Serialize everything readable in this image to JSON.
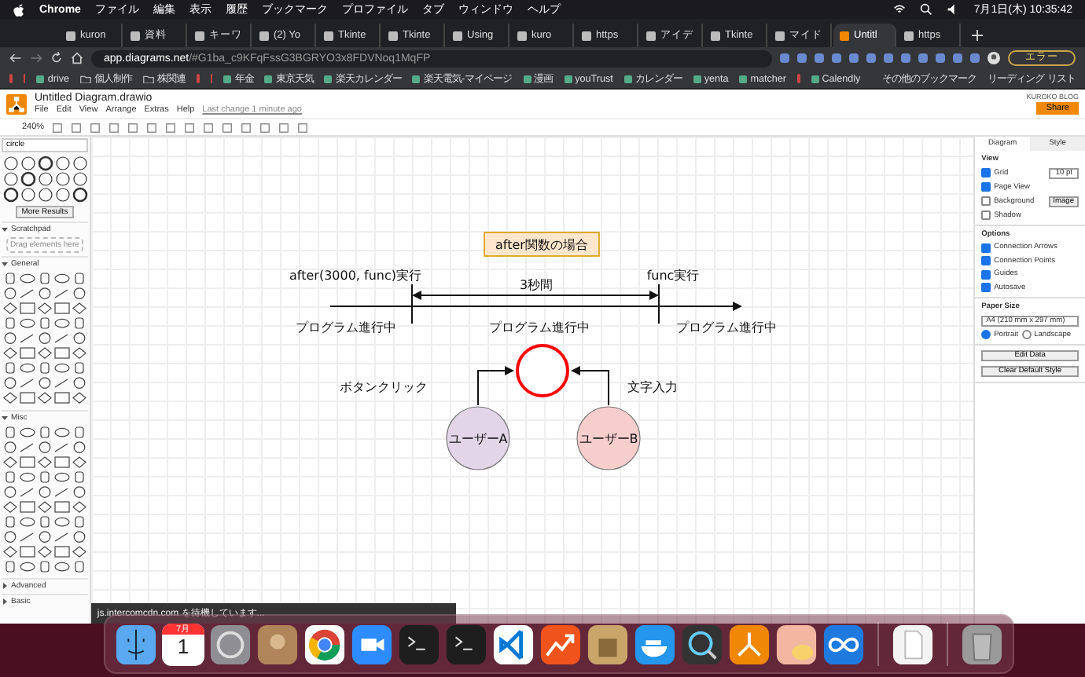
{
  "menubar": {
    "app": "Chrome",
    "items": [
      "ファイル",
      "編集",
      "表示",
      "履歴",
      "ブックマーク",
      "プロファイル",
      "タブ",
      "ウィンドウ",
      "ヘルプ"
    ],
    "clock": "7月1日(木) 10:35:42"
  },
  "browser": {
    "tabs": [
      {
        "label": "kuron",
        "selected": false
      },
      {
        "label": "資料",
        "selected": false
      },
      {
        "label": "キーワ",
        "selected": false
      },
      {
        "label": "(2) Yo",
        "selected": false
      },
      {
        "label": "Tkinte",
        "selected": false
      },
      {
        "label": "Tkinte",
        "selected": false
      },
      {
        "label": "Using",
        "selected": false
      },
      {
        "label": "kuro",
        "selected": false
      },
      {
        "label": "https",
        "selected": false
      },
      {
        "label": "アイデ",
        "selected": false
      },
      {
        "label": "Tkinte",
        "selected": false
      },
      {
        "label": "マイド",
        "selected": false
      },
      {
        "label": "Untitl",
        "selected": true
      },
      {
        "label": "https",
        "selected": false
      }
    ],
    "url_host": "app.diagrams.net",
    "url_path": "/#G1ba_c9KFqFssG3BGRYO3x8FDVNoq1MqFP",
    "error_button": "エラー",
    "bookmarks": [
      {
        "kind": "icon"
      },
      {
        "kind": "icon"
      },
      {
        "kind": "site",
        "label": "drive"
      },
      {
        "kind": "folder",
        "label": "個人制作"
      },
      {
        "kind": "folder",
        "label": "株関連"
      },
      {
        "kind": "icon"
      },
      {
        "kind": "icon"
      },
      {
        "kind": "site",
        "label": "年金"
      },
      {
        "kind": "site",
        "label": "東京天気"
      },
      {
        "kind": "site",
        "label": "楽天カレンダー"
      },
      {
        "kind": "site",
        "label": "楽天電気-マイページ"
      },
      {
        "kind": "site",
        "label": "漫画"
      },
      {
        "kind": "site",
        "label": "youTrust"
      },
      {
        "kind": "site",
        "label": "カレンダー"
      },
      {
        "kind": "site",
        "label": "yenta"
      },
      {
        "kind": "site",
        "label": "matcher"
      },
      {
        "kind": "icon"
      },
      {
        "kind": "site",
        "label": "Calendly"
      }
    ],
    "other_bookmarks": "その他のブックマーク",
    "reading_list": "リーディング リスト"
  },
  "app": {
    "title": "Untitled Diagram.drawio",
    "menu": [
      "File",
      "Edit",
      "View",
      "Arrange",
      "Extras",
      "Help"
    ],
    "last_change": "Last change 1 minute ago",
    "account": "KUROKO BLOG",
    "share": "Share",
    "zoom": "240%"
  },
  "sidebar": {
    "search": "circle",
    "more_results": "More Results",
    "sections": [
      {
        "title": "Scratchpad",
        "kind": "scratchpad",
        "expanded": true,
        "hint": "Drag elements here"
      },
      {
        "title": "General",
        "kind": "general",
        "expanded": true
      },
      {
        "title": "Misc",
        "kind": "misc",
        "expanded": true
      },
      {
        "title": "Advanced",
        "expanded": false
      },
      {
        "title": "Basic",
        "expanded": false
      }
    ]
  },
  "diagram": {
    "title": "after関数の場合",
    "start_label": "after(3000, func)実行",
    "interval": "3秒間",
    "end_label": "func実行",
    "phases": [
      "プログラム進行中",
      "プログラム進行中",
      "プログラム進行中"
    ],
    "users": [
      {
        "name": "ユーザーA",
        "action": "ボタンクリック",
        "color": "#e1d5e7"
      },
      {
        "name": "ユーザーB",
        "action": "文字入力",
        "color": "#f8cecc"
      }
    ]
  },
  "format_panel": {
    "tabs": [
      {
        "label": "Diagram",
        "selected": true
      },
      {
        "label": "Style",
        "selected": false
      }
    ],
    "view_heading": "View",
    "grid_size": "10 pt",
    "image_button": "Image",
    "view_options": [
      {
        "label": "Grid",
        "checked": true
      },
      {
        "label": "Page View",
        "checked": true
      },
      {
        "label": "Background",
        "checked": false
      },
      {
        "label": "Shadow",
        "checked": false
      }
    ],
    "options_heading": "Options",
    "options": [
      {
        "label": "Connection Arrows",
        "checked": true
      },
      {
        "label": "Connection Points",
        "checked": true
      },
      {
        "label": "Guides",
        "checked": true
      },
      {
        "label": "Autosave",
        "checked": true
      }
    ],
    "paper_heading": "Paper Size",
    "paper": "A4 (210 mm x 297 mm)",
    "orientations": [
      {
        "label": "Portrait",
        "selected": true
      },
      {
        "label": "Landscape",
        "selected": false
      }
    ],
    "buttons": [
      "Edit Data",
      "Clear Default Style"
    ]
  },
  "status": "js.intercomcdn.com を待機しています...",
  "dock": [
    {
      "kind": "finder"
    },
    {
      "kind": "calendar",
      "month": "7月",
      "day": "1"
    },
    {
      "kind": "settings"
    },
    {
      "kind": "contacts"
    },
    {
      "kind": "browser"
    },
    {
      "kind": "video"
    },
    {
      "kind": "terminal"
    },
    {
      "kind": "terminal"
    },
    {
      "kind": "editor"
    },
    {
      "kind": "chart"
    },
    {
      "kind": "archive"
    },
    {
      "kind": "whale"
    },
    {
      "kind": "magnifier"
    },
    {
      "kind": "flowchart"
    },
    {
      "kind": "preview"
    },
    {
      "kind": "infinity"
    },
    {
      "kind": "separator"
    },
    {
      "kind": "document"
    },
    {
      "kind": "separator"
    },
    {
      "kind": "trash"
    }
  ]
}
